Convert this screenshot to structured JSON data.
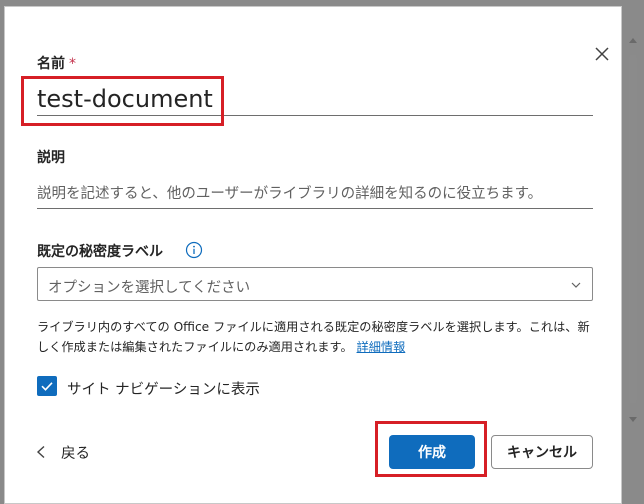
{
  "form": {
    "name_label": "名前",
    "required_mark": "*",
    "name_value": "test-document",
    "description_label": "説明",
    "description_placeholder": "説明を記述すると、他のユーザーがライブラリの詳細を知るのに役立ちます。",
    "sensitivity_label": "既定の秘密度ラベル",
    "sensitivity_placeholder": "オプションを選択してください",
    "help_text": "ライブラリ内のすべての Office ファイルに適用される既定の秘密度ラベルを選択します。これは、新しく作成または編集されたファイルにのみ適用されます。",
    "help_link": "詳細情報",
    "show_in_nav_label": "サイト ナビゲーションに表示",
    "show_in_nav_checked": true
  },
  "footer": {
    "back_label": "戻る",
    "create_label": "作成",
    "cancel_label": "キャンセル"
  },
  "colors": {
    "accent": "#0f6cbd",
    "highlight": "#d61f26",
    "required": "#c4314b"
  },
  "icons": {
    "close": "close-icon",
    "info": "info-icon",
    "chevron": "chevron-down-icon",
    "back": "chevron-left-icon",
    "check": "checkmark-icon"
  }
}
